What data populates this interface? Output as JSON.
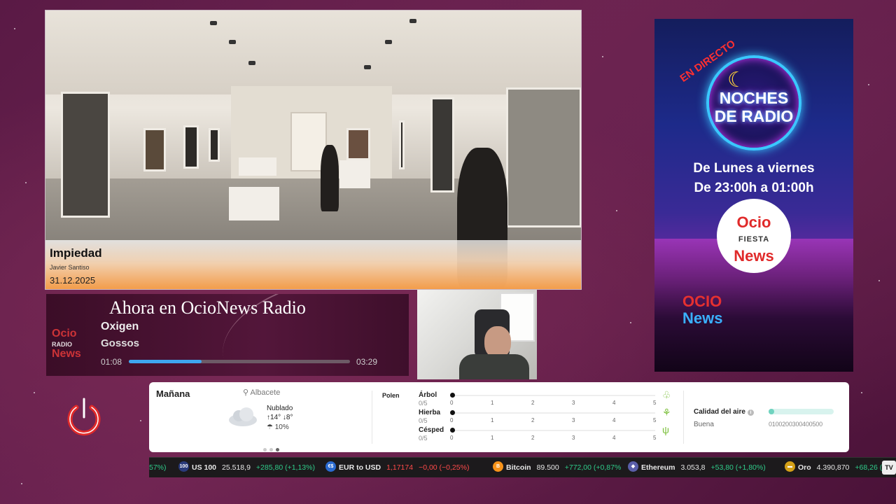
{
  "feature": {
    "title": "Impiedad",
    "author": "Javier Santiso",
    "date": "31.12.2025"
  },
  "now_playing": {
    "heading": "Ahora en OcioNews Radio",
    "song": "Oxigen",
    "artist": "Gossos",
    "current_time": "01:08",
    "total_time": "03:29",
    "progress": 0.33
  },
  "ad": {
    "live_label": "EN DIRECTO",
    "show_title": "NOCHES DE RADIO",
    "schedule_line1": "De Lunes a viernes",
    "schedule_line2": "De 23:00h a 01:00h",
    "logo_top": "Ocio",
    "logo_mid": "FIESTA",
    "logo_bottom": "News",
    "brand_top": "OCIO",
    "brand_bottom": "News"
  },
  "weather": {
    "day": "Mañana",
    "location": "Albacete",
    "condition": "Nublado",
    "temp_max": "14°",
    "temp_min": "8°",
    "rain_prob": "10%",
    "polen_label": "Polen",
    "polen": [
      {
        "name": "Árbol",
        "value": "0/5",
        "level": 0,
        "icon": "tree-icon"
      },
      {
        "name": "Hierba",
        "value": "0/5",
        "level": 0,
        "icon": "herb-icon"
      },
      {
        "name": "Césped",
        "value": "0/5",
        "level": 0,
        "icon": "grass-icon"
      }
    ],
    "polen_scale": [
      "0",
      "1",
      "2",
      "3",
      "4",
      "5"
    ],
    "air_quality_label": "Calidad del aire",
    "air_quality_status": "Buena",
    "air_quality_scale": "0100200300400500"
  },
  "ticker": [
    {
      "symbol": "",
      "price": "",
      "change": "57%)",
      "direction": "up",
      "icon": "",
      "color": ""
    },
    {
      "symbol": "US 100",
      "price": "25.518,9",
      "change": "+285,80 (+1,13%)",
      "direction": "up",
      "icon": "100",
      "color": "#2a3a7a"
    },
    {
      "symbol": "EUR to USD",
      "price": "1,17174",
      "change": "−0,00 (−0,25%)",
      "direction": "down",
      "icon": "€$",
      "color": "#2a6ad0"
    },
    {
      "symbol": "Bitcoin",
      "price": "89.500",
      "change": "+772,00 (+0,87%",
      "direction": "up",
      "icon": "B",
      "color": "#f7931a"
    },
    {
      "symbol": "Ethereum",
      "price": "3.053,8",
      "change": "+53,80 (+1,80%)",
      "direction": "up",
      "icon": "◆",
      "color": "#5a5ea8"
    },
    {
      "symbol": "Oro",
      "price": "4.390,870",
      "change": "+68,26 (+",
      "direction": "up",
      "icon": "▬",
      "color": "#d4a017"
    }
  ],
  "colors": {
    "accent_blue": "#3ea6f0",
    "brand_red": "#e63030",
    "up": "#2fcc8a",
    "down": "#ff4a4a"
  }
}
